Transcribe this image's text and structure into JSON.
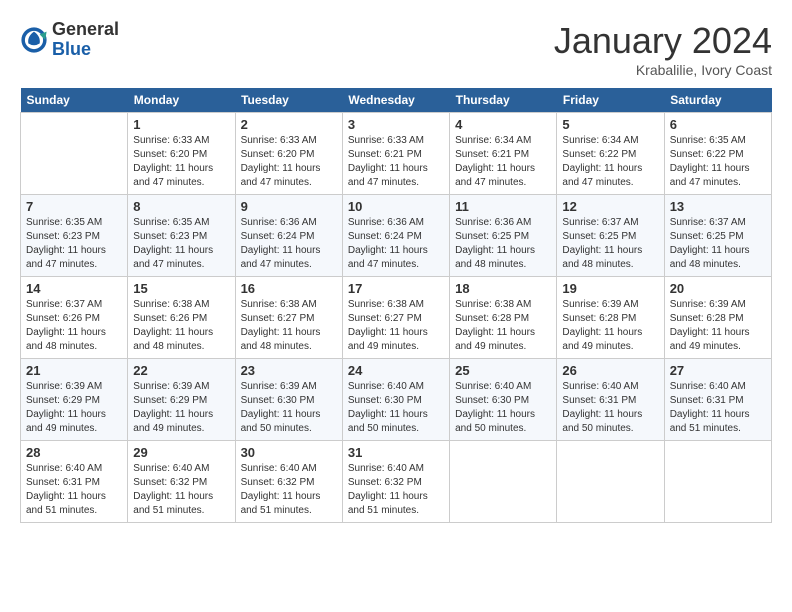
{
  "header": {
    "logo_general": "General",
    "logo_blue": "Blue",
    "month_title": "January 2024",
    "subtitle": "Krabalilie, Ivory Coast"
  },
  "days": [
    "Sunday",
    "Monday",
    "Tuesday",
    "Wednesday",
    "Thursday",
    "Friday",
    "Saturday"
  ],
  "weeks": [
    [
      {
        "date": "",
        "sunrise": "",
        "sunset": "",
        "daylight": ""
      },
      {
        "date": "1",
        "sunrise": "Sunrise: 6:33 AM",
        "sunset": "Sunset: 6:20 PM",
        "daylight": "Daylight: 11 hours and 47 minutes."
      },
      {
        "date": "2",
        "sunrise": "Sunrise: 6:33 AM",
        "sunset": "Sunset: 6:20 PM",
        "daylight": "Daylight: 11 hours and 47 minutes."
      },
      {
        "date": "3",
        "sunrise": "Sunrise: 6:33 AM",
        "sunset": "Sunset: 6:21 PM",
        "daylight": "Daylight: 11 hours and 47 minutes."
      },
      {
        "date": "4",
        "sunrise": "Sunrise: 6:34 AM",
        "sunset": "Sunset: 6:21 PM",
        "daylight": "Daylight: 11 hours and 47 minutes."
      },
      {
        "date": "5",
        "sunrise": "Sunrise: 6:34 AM",
        "sunset": "Sunset: 6:22 PM",
        "daylight": "Daylight: 11 hours and 47 minutes."
      },
      {
        "date": "6",
        "sunrise": "Sunrise: 6:35 AM",
        "sunset": "Sunset: 6:22 PM",
        "daylight": "Daylight: 11 hours and 47 minutes."
      }
    ],
    [
      {
        "date": "7",
        "sunrise": "Sunrise: 6:35 AM",
        "sunset": "Sunset: 6:23 PM",
        "daylight": "Daylight: 11 hours and 47 minutes."
      },
      {
        "date": "8",
        "sunrise": "Sunrise: 6:35 AM",
        "sunset": "Sunset: 6:23 PM",
        "daylight": "Daylight: 11 hours and 47 minutes."
      },
      {
        "date": "9",
        "sunrise": "Sunrise: 6:36 AM",
        "sunset": "Sunset: 6:24 PM",
        "daylight": "Daylight: 11 hours and 47 minutes."
      },
      {
        "date": "10",
        "sunrise": "Sunrise: 6:36 AM",
        "sunset": "Sunset: 6:24 PM",
        "daylight": "Daylight: 11 hours and 47 minutes."
      },
      {
        "date": "11",
        "sunrise": "Sunrise: 6:36 AM",
        "sunset": "Sunset: 6:25 PM",
        "daylight": "Daylight: 11 hours and 48 minutes."
      },
      {
        "date": "12",
        "sunrise": "Sunrise: 6:37 AM",
        "sunset": "Sunset: 6:25 PM",
        "daylight": "Daylight: 11 hours and 48 minutes."
      },
      {
        "date": "13",
        "sunrise": "Sunrise: 6:37 AM",
        "sunset": "Sunset: 6:25 PM",
        "daylight": "Daylight: 11 hours and 48 minutes."
      }
    ],
    [
      {
        "date": "14",
        "sunrise": "Sunrise: 6:37 AM",
        "sunset": "Sunset: 6:26 PM",
        "daylight": "Daylight: 11 hours and 48 minutes."
      },
      {
        "date": "15",
        "sunrise": "Sunrise: 6:38 AM",
        "sunset": "Sunset: 6:26 PM",
        "daylight": "Daylight: 11 hours and 48 minutes."
      },
      {
        "date": "16",
        "sunrise": "Sunrise: 6:38 AM",
        "sunset": "Sunset: 6:27 PM",
        "daylight": "Daylight: 11 hours and 48 minutes."
      },
      {
        "date": "17",
        "sunrise": "Sunrise: 6:38 AM",
        "sunset": "Sunset: 6:27 PM",
        "daylight": "Daylight: 11 hours and 49 minutes."
      },
      {
        "date": "18",
        "sunrise": "Sunrise: 6:38 AM",
        "sunset": "Sunset: 6:28 PM",
        "daylight": "Daylight: 11 hours and 49 minutes."
      },
      {
        "date": "19",
        "sunrise": "Sunrise: 6:39 AM",
        "sunset": "Sunset: 6:28 PM",
        "daylight": "Daylight: 11 hours and 49 minutes."
      },
      {
        "date": "20",
        "sunrise": "Sunrise: 6:39 AM",
        "sunset": "Sunset: 6:28 PM",
        "daylight": "Daylight: 11 hours and 49 minutes."
      }
    ],
    [
      {
        "date": "21",
        "sunrise": "Sunrise: 6:39 AM",
        "sunset": "Sunset: 6:29 PM",
        "daylight": "Daylight: 11 hours and 49 minutes."
      },
      {
        "date": "22",
        "sunrise": "Sunrise: 6:39 AM",
        "sunset": "Sunset: 6:29 PM",
        "daylight": "Daylight: 11 hours and 49 minutes."
      },
      {
        "date": "23",
        "sunrise": "Sunrise: 6:39 AM",
        "sunset": "Sunset: 6:30 PM",
        "daylight": "Daylight: 11 hours and 50 minutes."
      },
      {
        "date": "24",
        "sunrise": "Sunrise: 6:40 AM",
        "sunset": "Sunset: 6:30 PM",
        "daylight": "Daylight: 11 hours and 50 minutes."
      },
      {
        "date": "25",
        "sunrise": "Sunrise: 6:40 AM",
        "sunset": "Sunset: 6:30 PM",
        "daylight": "Daylight: 11 hours and 50 minutes."
      },
      {
        "date": "26",
        "sunrise": "Sunrise: 6:40 AM",
        "sunset": "Sunset: 6:31 PM",
        "daylight": "Daylight: 11 hours and 50 minutes."
      },
      {
        "date": "27",
        "sunrise": "Sunrise: 6:40 AM",
        "sunset": "Sunset: 6:31 PM",
        "daylight": "Daylight: 11 hours and 51 minutes."
      }
    ],
    [
      {
        "date": "28",
        "sunrise": "Sunrise: 6:40 AM",
        "sunset": "Sunset: 6:31 PM",
        "daylight": "Daylight: 11 hours and 51 minutes."
      },
      {
        "date": "29",
        "sunrise": "Sunrise: 6:40 AM",
        "sunset": "Sunset: 6:32 PM",
        "daylight": "Daylight: 11 hours and 51 minutes."
      },
      {
        "date": "30",
        "sunrise": "Sunrise: 6:40 AM",
        "sunset": "Sunset: 6:32 PM",
        "daylight": "Daylight: 11 hours and 51 minutes."
      },
      {
        "date": "31",
        "sunrise": "Sunrise: 6:40 AM",
        "sunset": "Sunset: 6:32 PM",
        "daylight": "Daylight: 11 hours and 51 minutes."
      },
      {
        "date": "",
        "sunrise": "",
        "sunset": "",
        "daylight": ""
      },
      {
        "date": "",
        "sunrise": "",
        "sunset": "",
        "daylight": ""
      },
      {
        "date": "",
        "sunrise": "",
        "sunset": "",
        "daylight": ""
      }
    ]
  ]
}
